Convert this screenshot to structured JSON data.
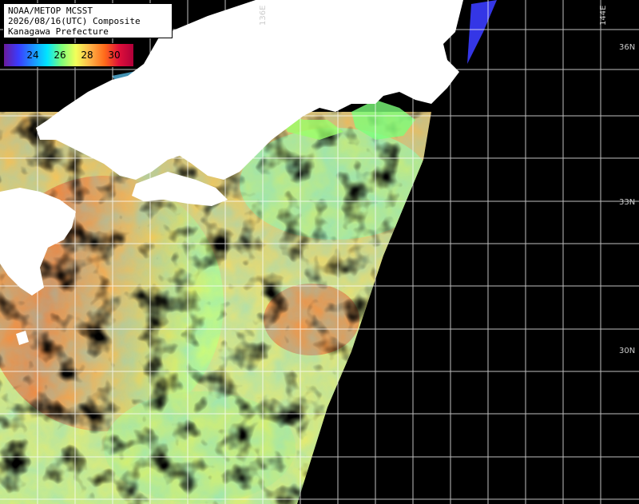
{
  "title": {
    "line1": "NOAA/METOP MCSST",
    "line2": "2026/08/16(UTC) Composite",
    "line3": "Kanagawa Prefecture"
  },
  "legend": {
    "ticks": [
      "24",
      "26",
      "28",
      "30"
    ],
    "colors": [
      "#6a1b9a",
      "#3a3cff",
      "#1e90ff",
      "#00e5ff",
      "#7dff7a",
      "#f2ff5a",
      "#ffb347",
      "#ff6a1a",
      "#e0103a",
      "#b0003a"
    ]
  },
  "grid": {
    "lon_labels": [
      "136E",
      "144E"
    ],
    "lat_labels": [
      "36N",
      "33N",
      "30N"
    ]
  },
  "colors": {
    "land": "#ffffff",
    "no_data": "#000000",
    "grid": "#ffffff"
  }
}
